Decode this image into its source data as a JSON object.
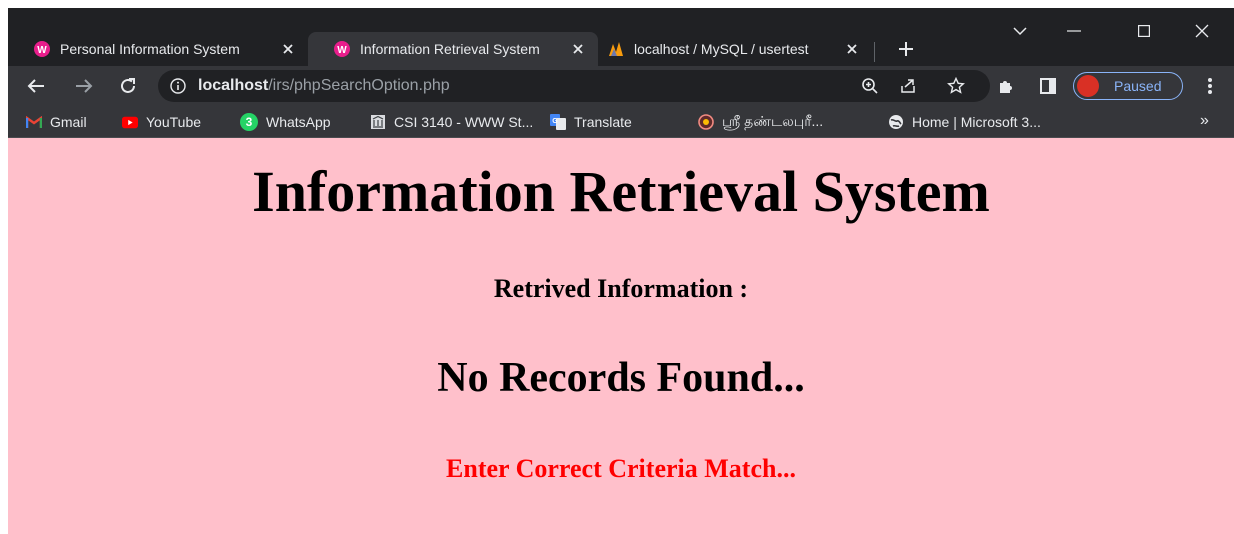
{
  "browser": {
    "tabs": [
      {
        "title": "Personal Information System",
        "active": false
      },
      {
        "title": "Information Retrieval System",
        "active": true
      },
      {
        "title": "localhost / MySQL / usertest",
        "active": false
      }
    ],
    "address": {
      "host": "localhost",
      "path": "/irs/phpSearchOption.php"
    },
    "profile_status": "Paused",
    "bookmarks": [
      {
        "label": "Gmail",
        "icon": "gmail-icon"
      },
      {
        "label": "YouTube",
        "icon": "youtube-icon"
      },
      {
        "label": "WhatsApp",
        "icon": "whatsapp-icon"
      },
      {
        "label": "CSI 3140 - WWW St...",
        "icon": "building-icon"
      },
      {
        "label": "Translate",
        "icon": "translate-icon"
      },
      {
        "label": "ஸ்ரீ தண்டலபுரீ...",
        "icon": "globe-orange-icon"
      },
      {
        "label": "Home | Microsoft 3...",
        "icon": "globe-icon"
      }
    ],
    "whatsapp_badge": "3",
    "colors": {
      "tabstrip": "#202124",
      "toolbar": "#35363a",
      "accent": "#8ab4f8"
    }
  },
  "page": {
    "title": "Information Retrieval System",
    "subtitle": "Retrived Information :",
    "no_records": "No Records Found...",
    "error_hint": "Enter Correct Criteria Match...",
    "colors": {
      "background": "#ffc0cb",
      "error": "#ff0000"
    }
  }
}
